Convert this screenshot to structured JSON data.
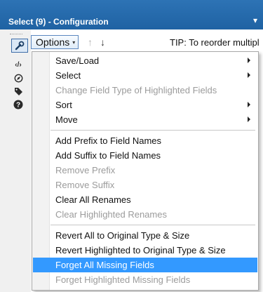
{
  "window": {
    "title": "Select (9) - Configuration",
    "pin_glyph": "▾"
  },
  "sidebar": {
    "tools": [
      {
        "icon": "wrench-icon",
        "glyph": "🔧"
      },
      {
        "icon": "code-icon",
        "glyph": "‹/›"
      },
      {
        "icon": "compass-icon",
        "glyph": "⊛"
      },
      {
        "icon": "tag-icon",
        "glyph": "◆"
      },
      {
        "icon": "help-icon",
        "glyph": "?"
      }
    ]
  },
  "toolbar": {
    "options_label": "Options",
    "options_arrow": "▾",
    "up_glyph": "↑",
    "down_glyph": "↓",
    "tip": "TIP: To reorder multipl"
  },
  "menu": {
    "items": [
      {
        "label": "Save/Load",
        "enabled": true,
        "submenu": true
      },
      {
        "label": "Select",
        "enabled": true,
        "submenu": true
      },
      {
        "label": "Change Field Type of Highlighted Fields",
        "enabled": false,
        "submenu": false
      },
      {
        "label": "Sort",
        "enabled": true,
        "submenu": true
      },
      {
        "label": "Move",
        "enabled": true,
        "submenu": true
      },
      {
        "label": "Add Prefix to Field Names",
        "enabled": true,
        "submenu": false
      },
      {
        "label": "Add Suffix to Field Names",
        "enabled": true,
        "submenu": false
      },
      {
        "label": "Remove Prefix",
        "enabled": false,
        "submenu": false
      },
      {
        "label": "Remove Suffix",
        "enabled": false,
        "submenu": false
      },
      {
        "label": "Clear All Renames",
        "enabled": true,
        "submenu": false
      },
      {
        "label": "Clear Highlighted Renames",
        "enabled": false,
        "submenu": false
      },
      {
        "label": "Revert All to Original Type & Size",
        "enabled": true,
        "submenu": false
      },
      {
        "label": "Revert Highlighted to Original Type & Size",
        "enabled": true,
        "submenu": false
      },
      {
        "label": "Forget All Missing Fields",
        "enabled": true,
        "submenu": false,
        "highlighted": true
      },
      {
        "label": "Forget Highlighted Missing Fields",
        "enabled": false,
        "submenu": false
      }
    ]
  },
  "colors": {
    "title_bar": "#2d73b5",
    "highlight": "#3399ff",
    "disabled_text": "#9b9b9b"
  }
}
